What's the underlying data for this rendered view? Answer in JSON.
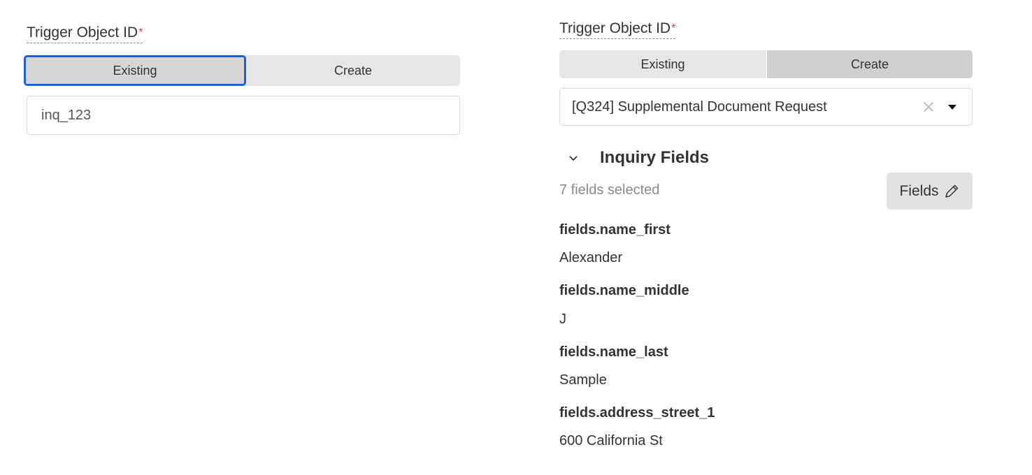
{
  "left": {
    "label": "Trigger Object ID",
    "required_mark": "*",
    "segments": [
      "Existing",
      "Create"
    ],
    "selected": "Existing",
    "input_value": "inq_123"
  },
  "right": {
    "label": "Trigger Object ID",
    "required_mark": "*",
    "segments": [
      "Existing",
      "Create"
    ],
    "selected": "Create",
    "select_value": "[Q324] Supplemental Document Request",
    "section_title": "Inquiry Fields",
    "fields_count": "7 fields selected",
    "fields_button": "Fields",
    "fields": [
      {
        "key": "fields.name_first",
        "value": "Alexander"
      },
      {
        "key": "fields.name_middle",
        "value": "J"
      },
      {
        "key": "fields.name_last",
        "value": "Sample"
      },
      {
        "key": "fields.address_street_1",
        "value": "600 California St"
      }
    ]
  },
  "icons": {
    "clear": "close-icon",
    "dropdown": "caret-down-icon",
    "collapse": "chevron-down-icon",
    "edit": "pencil-icon"
  },
  "colors": {
    "focus_outline": "#1f5fd6",
    "required": "#d43b3b"
  }
}
